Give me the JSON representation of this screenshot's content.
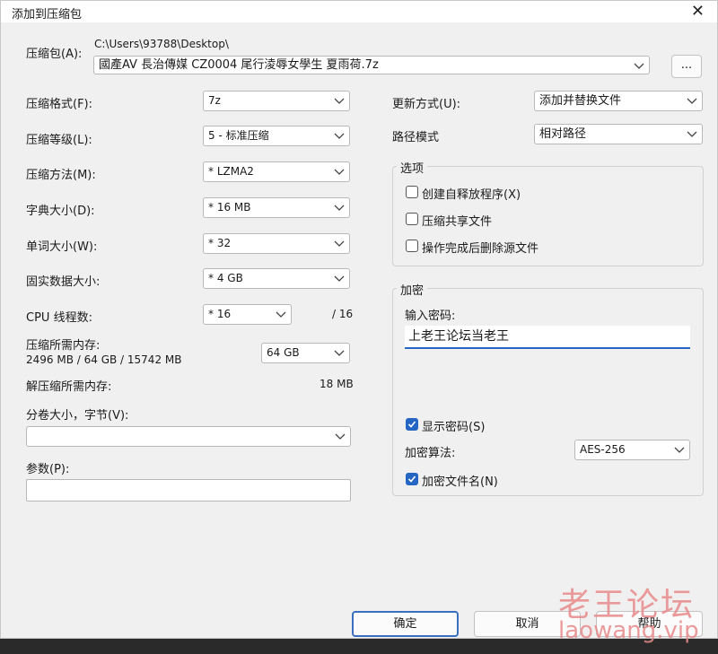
{
  "window": {
    "title": "添加到压缩包",
    "close_glyph": "✕"
  },
  "archive": {
    "label": "压缩包(A):",
    "path": "C:\\Users\\93788\\Desktop\\",
    "filename": "國產AV 長治傳媒 CZ0004 尾行淩辱女學生 夏雨荷.7z",
    "browse_label": "..."
  },
  "left": {
    "format": {
      "label": "压缩格式(F):",
      "value": "7z"
    },
    "level": {
      "label": "压缩等级(L):",
      "value": "5 - 标准压缩"
    },
    "method": {
      "label": "压缩方法(M):",
      "value": "* LZMA2"
    },
    "dict": {
      "label": "字典大小(D):",
      "value": "* 16 MB"
    },
    "word": {
      "label": "单词大小(W):",
      "value": "* 32"
    },
    "solid": {
      "label": "固实数据大小:",
      "value": "* 4 GB"
    },
    "threads": {
      "label": "CPU 线程数:",
      "value": "* 16",
      "max": "/ 16"
    },
    "mem_compress": {
      "label": "压缩所需内存:",
      "detail": "2496 MB / 64 GB / 15742 MB",
      "value": "64 GB"
    },
    "mem_decompress": {
      "label": "解压缩所需内存:",
      "value": "18 MB"
    },
    "volume": {
      "label": "分卷大小，字节(V):",
      "value": ""
    },
    "params": {
      "label": "参数(P):",
      "value": ""
    }
  },
  "right": {
    "update": {
      "label": "更新方式(U):",
      "value": "添加并替换文件"
    },
    "pathmode": {
      "label": "路径模式",
      "value": "相对路径"
    },
    "options": {
      "title": "选项",
      "sfx": "创建自释放程序(X)",
      "shared": "压缩共享文件",
      "delete": "操作完成后删除源文件"
    },
    "encryption": {
      "title": "加密",
      "password_label": "输入密码:",
      "password": "上老王论坛当老王",
      "show_password": "显示密码(S)",
      "method_label": "加密算法:",
      "method": "AES-256",
      "encrypt_names": "加密文件名(N)"
    }
  },
  "buttons": {
    "ok": "确定",
    "cancel": "取消",
    "help": "帮助"
  },
  "watermark": {
    "line1": "老王论坛",
    "line2": "laowang.vip"
  },
  "colors": {
    "accent": "#2566c4",
    "watermark": "#e88a8a"
  }
}
